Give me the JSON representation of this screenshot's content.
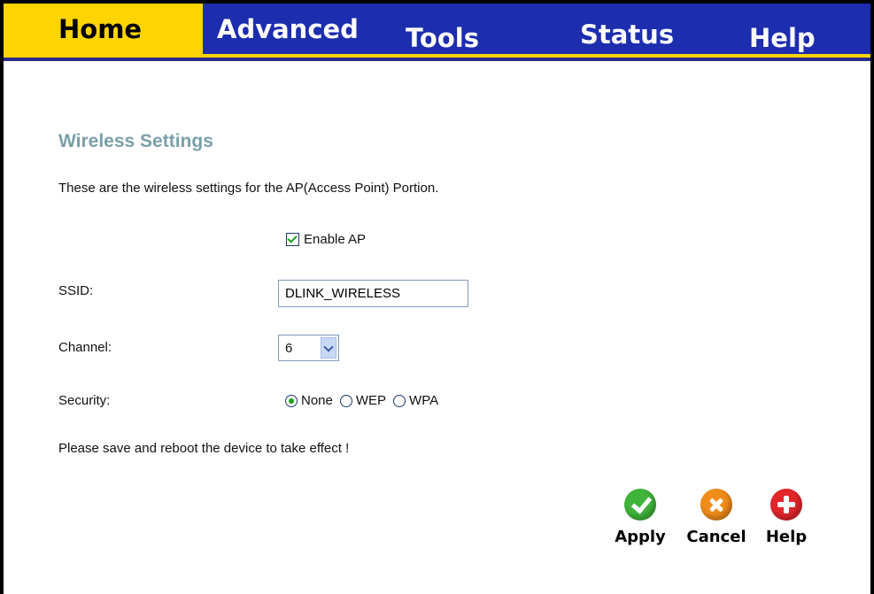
{
  "tabs": {
    "home": "Home",
    "advanced": "Advanced",
    "tools": "Tools",
    "status": "Status",
    "help": "Help"
  },
  "page": {
    "title": "Wireless Settings",
    "description": "These are the wireless settings for the AP(Access Point) Portion.",
    "note": "Please save and reboot the device to take effect !"
  },
  "form": {
    "enable_ap_label": "Enable AP",
    "enable_ap_checked": true,
    "ssid_label": "SSID:",
    "ssid_value": "DLINK_WIRELESS",
    "channel_label": "Channel:",
    "channel_value": "6",
    "security_label": "Security:",
    "security_options": [
      "None",
      "WEP",
      "WPA"
    ],
    "security_selected": "None"
  },
  "actions": {
    "apply": "Apply",
    "cancel": "Cancel",
    "help": "Help"
  },
  "colors": {
    "tab_active": "#ffd400",
    "tab_inactive": "#1c2dae",
    "title": "#7a9fa9",
    "apply_icon": "#3fb43a",
    "cancel_icon": "#f08c18",
    "help_icon": "#e3262a"
  }
}
